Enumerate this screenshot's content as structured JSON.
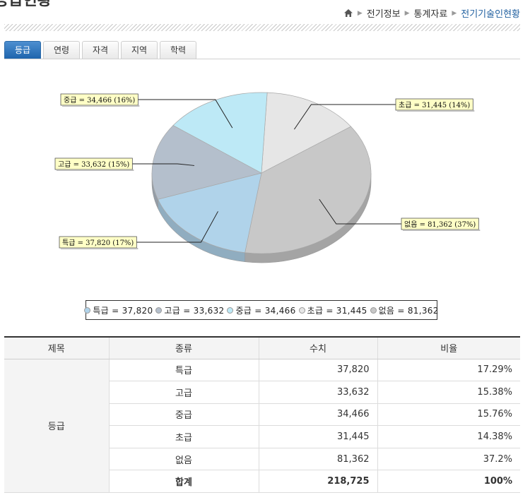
{
  "page": {
    "title_fragment": "등급현황"
  },
  "breadcrumb": {
    "items": [
      "전기정보",
      "통계자료"
    ],
    "current": "전기기술인현황"
  },
  "tabs": [
    {
      "label": "등급",
      "active": true
    },
    {
      "label": "연령",
      "active": false
    },
    {
      "label": "자격",
      "active": false
    },
    {
      "label": "지역",
      "active": false
    },
    {
      "label": "학력",
      "active": false
    }
  ],
  "chart_data": {
    "type": "pie",
    "title": "",
    "slices": [
      {
        "name": "특급",
        "value": 37820,
        "percent": 17,
        "color": "#b0d3ea",
        "label": "특급 = 37,820 (17%)"
      },
      {
        "name": "고급",
        "value": 33632,
        "percent": 15,
        "color": "#b4bfcc",
        "label": "고급 = 33,632 (15%)"
      },
      {
        "name": "중급",
        "value": 34466,
        "percent": 16,
        "color": "#bde9f6",
        "label": "중급 = 34,466 (16%)"
      },
      {
        "name": "초급",
        "value": 31445,
        "percent": 14,
        "color": "#e6e6e6",
        "label": "초급 = 31,445 (14%)"
      },
      {
        "name": "없음",
        "value": 81362,
        "percent": 37,
        "color": "#c8c8c8",
        "label": "없음 = 81,362 (37%)"
      }
    ],
    "legend_placement": "bottom",
    "legend": [
      "특급 = 37,820",
      "고급 = 33,632",
      "중급 = 34,466",
      "초급 = 31,445",
      "없음 = 81,362"
    ]
  },
  "table": {
    "headers": [
      "제목",
      "종류",
      "수치",
      "비율"
    ],
    "group_title": "등급",
    "rows": [
      {
        "kind": "특급",
        "value": "37,820",
        "ratio": "17.29%"
      },
      {
        "kind": "고급",
        "value": "33,632",
        "ratio": "15.38%"
      },
      {
        "kind": "중급",
        "value": "34,466",
        "ratio": "15.76%"
      },
      {
        "kind": "초급",
        "value": "31,445",
        "ratio": "14.38%"
      },
      {
        "kind": "없음",
        "value": "81,362",
        "ratio": "37.2%"
      }
    ],
    "total": {
      "kind": "합계",
      "value": "218,725",
      "ratio": "100%"
    }
  },
  "colors": {
    "accent": "#1e64ad",
    "breadcrumb_current": "#1f5f9f",
    "label_bg": "#ffffc6"
  }
}
